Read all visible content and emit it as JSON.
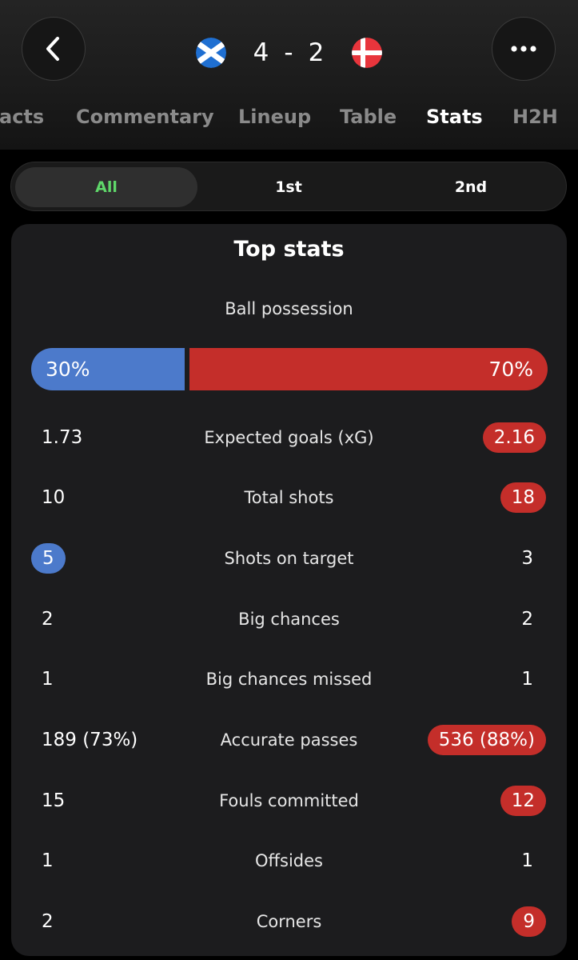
{
  "header": {
    "score": {
      "home": "4",
      "separator": "-",
      "away": "2"
    },
    "home_team": {
      "flag": "scotland-flag",
      "color": "#1f6fd1"
    },
    "away_team": {
      "flag": "denmark-flag",
      "color": "#e8353c"
    },
    "back_icon": "chevron-left-icon",
    "more_icon": "more-horizontal-icon"
  },
  "tabs": [
    {
      "label": "acts"
    },
    {
      "label": "Commentary"
    },
    {
      "label": "Lineup"
    },
    {
      "label": "Table"
    },
    {
      "label": "Stats",
      "active": true
    },
    {
      "label": "H2H"
    }
  ],
  "period_filter": {
    "options": [
      "All",
      "1st",
      "2nd"
    ],
    "selected": "All"
  },
  "top_stats": {
    "title": "Top stats",
    "possession": {
      "label": "Ball possession",
      "home": "30%",
      "away": "70%",
      "home_fraction": 0.3
    },
    "rows": [
      {
        "label": "Expected goals (xG)",
        "home": "1.73",
        "away": "2.16",
        "highlight": "away"
      },
      {
        "label": "Total shots",
        "home": "10",
        "away": "18",
        "highlight": "away"
      },
      {
        "label": "Shots on target",
        "home": "5",
        "away": "3",
        "highlight": "home"
      },
      {
        "label": "Big chances",
        "home": "2",
        "away": "2",
        "highlight": "none"
      },
      {
        "label": "Big chances missed",
        "home": "1",
        "away": "1",
        "highlight": "none"
      },
      {
        "label": "Accurate passes",
        "home": "189 (73%)",
        "away": "536 (88%)",
        "highlight": "away"
      },
      {
        "label": "Fouls committed",
        "home": "15",
        "away": "12",
        "highlight": "away"
      },
      {
        "label": "Offsides",
        "home": "1",
        "away": "1",
        "highlight": "none"
      },
      {
        "label": "Corners",
        "home": "2",
        "away": "9",
        "highlight": "away"
      }
    ]
  },
  "colors": {
    "home": "#4c7acb",
    "away": "#c42e2a",
    "active_filter_text": "#5fd86a",
    "inactive_tab_text": "#8a8a8a"
  }
}
